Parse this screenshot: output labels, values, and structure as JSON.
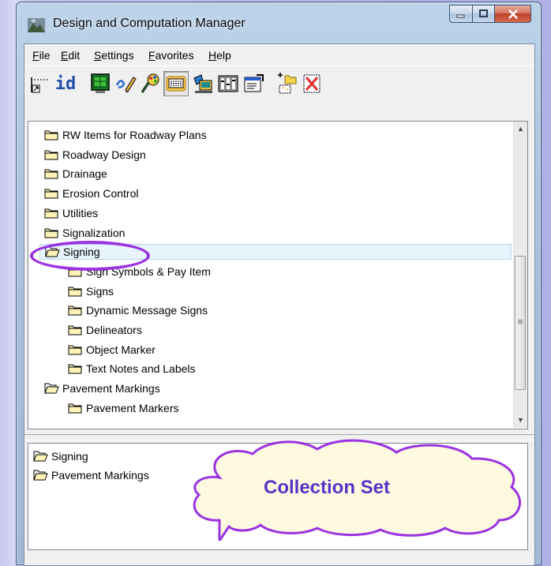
{
  "window": {
    "title": "Design and Computation Manager"
  },
  "menu": {
    "items": [
      {
        "label": "File",
        "accel": "F",
        "rest": "ile"
      },
      {
        "label": "Edit",
        "accel": "E",
        "rest": "dit"
      },
      {
        "label": "Settings",
        "accel": "S",
        "rest": "ettings"
      },
      {
        "label": "Favorites",
        "accel": "F",
        "rest": "avorites"
      },
      {
        "label": "Help",
        "accel": "H",
        "rest": "elp"
      }
    ]
  },
  "toolbar": {
    "id_label": "id",
    "icons": [
      "dimension-icon",
      "id-icon",
      "monitor-icon",
      "pencil-icon",
      "palette-icon",
      "keyboard-icon",
      "display-icon",
      "columns-icon",
      "properties-icon",
      "add-folder-icon",
      "delete-icon"
    ]
  },
  "tree": {
    "items": [
      {
        "label": "RW Items for Roadway Plans",
        "level": 0,
        "open": false
      },
      {
        "label": "Roadway Design",
        "level": 0,
        "open": false
      },
      {
        "label": "Drainage",
        "level": 0,
        "open": false
      },
      {
        "label": "Erosion Control",
        "level": 0,
        "open": false
      },
      {
        "label": "Utilities",
        "level": 0,
        "open": false
      },
      {
        "label": "Signalization",
        "level": 0,
        "open": false
      },
      {
        "label": "Signing",
        "level": 0,
        "open": true,
        "selected": true
      },
      {
        "label": "Sign Symbols & Pay Item",
        "level": 1,
        "open": false
      },
      {
        "label": "Signs",
        "level": 1,
        "open": false
      },
      {
        "label": "Dynamic Message Signs",
        "level": 1,
        "open": false
      },
      {
        "label": "Delineators",
        "level": 1,
        "open": false
      },
      {
        "label": "Object Marker",
        "level": 1,
        "open": false
      },
      {
        "label": "Text Notes and Labels",
        "level": 1,
        "open": false
      },
      {
        "label": "Pavement Markings",
        "level": 0,
        "open": true
      },
      {
        "label": "Pavement Markers",
        "level": 1,
        "open": false
      }
    ]
  },
  "collection": {
    "items": [
      {
        "label": "Signing"
      },
      {
        "label": "Pavement Markings"
      }
    ]
  },
  "annotation": {
    "callout_text": "Collection Set",
    "ring_color": "#9b33e0",
    "text_color": "#5b31c7"
  }
}
